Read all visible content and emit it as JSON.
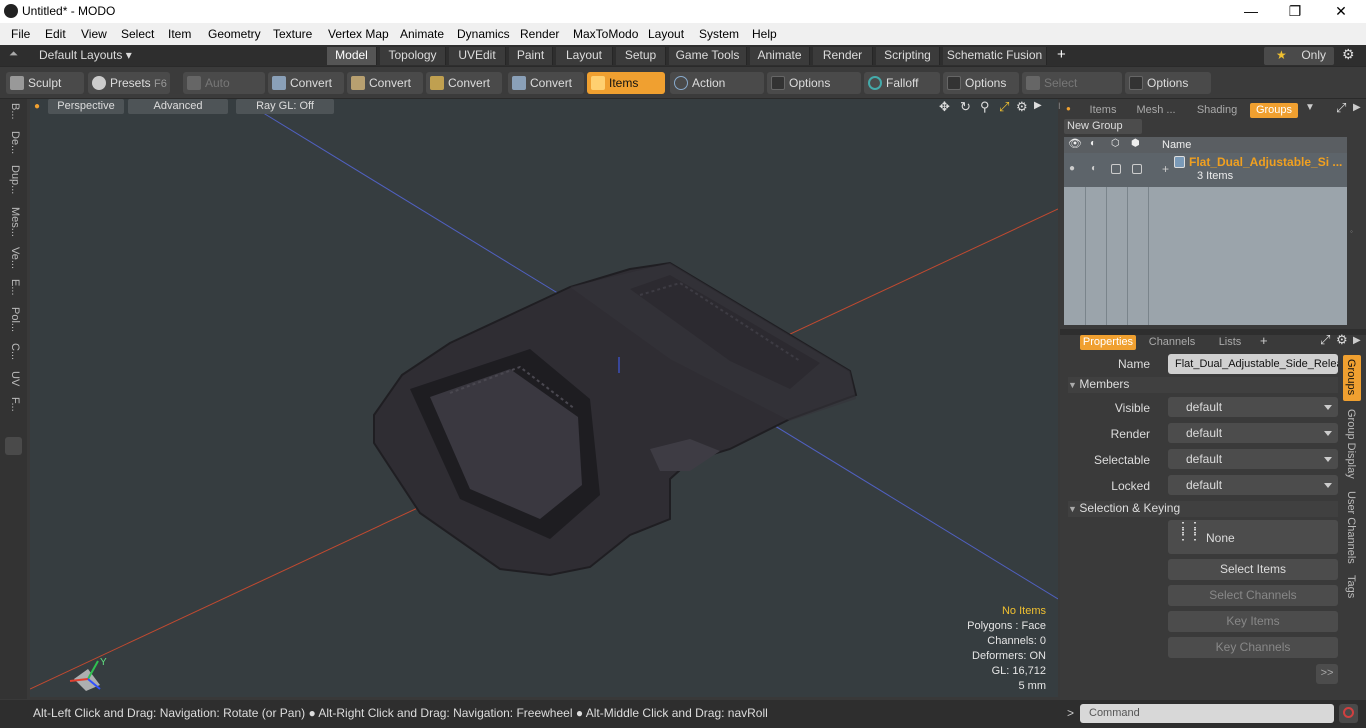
{
  "window": {
    "title": "Untitled* - MODO",
    "minimize": "—",
    "maximize": "❐",
    "close": "✕"
  },
  "menu": [
    "File",
    "Edit",
    "View",
    "Select",
    "Item",
    "Geometry",
    "Texture",
    "Vertex Map",
    "Animate",
    "Dynamics",
    "Render",
    "MaxToModo",
    "Layout",
    "System",
    "Help"
  ],
  "layouts": {
    "label": "Default Layouts ▾"
  },
  "tabs": [
    "Model",
    "Topology",
    "UVEdit",
    "Paint",
    "Layout",
    "Setup",
    "Game Tools",
    "Animate",
    "Render",
    "Scripting",
    "Schematic Fusion"
  ],
  "only": "Only",
  "toolbar": {
    "sculpt": "Sculpt",
    "presets": "Presets",
    "presets_key": "F6",
    "auto_select": "Auto Select",
    "convert": "Convert",
    "items": "Items",
    "action_center": "Action Center",
    "options": "Options",
    "falloff": "Falloff",
    "select_through": "Select Through"
  },
  "left_tabs": [
    "B...",
    "De...",
    "Dup...",
    "Mes...",
    "Ve...",
    "E...",
    "Pol...",
    "C...",
    "UV",
    "F..."
  ],
  "viewport": {
    "perspective": "Perspective",
    "advanced": "Advanced",
    "raygl": "Ray GL: Off"
  },
  "hud": {
    "selection": "No Items",
    "polygons": "Polygons : Face",
    "channels": "Channels: 0",
    "deformers": "Deformers: ON",
    "gl": "GL: 16,712",
    "unit": "5 mm"
  },
  "status": "Alt-Left Click and Drag: Navigation: Rotate (or Pan) ● Alt-Right Click and Drag: Navigation: Freewheel ● Alt-Middle Click and Drag: navRoll",
  "right_tabs": [
    "Items",
    "Mesh ...",
    "Shading",
    "Groups"
  ],
  "new_group": "New Group",
  "group_header": "Name",
  "group": {
    "name": "Flat_Dual_Adjustable_Si ...",
    "count": "3 Items"
  },
  "prop_tabs": [
    "Properties",
    "Channels",
    "Lists"
  ],
  "props": {
    "name_label": "Name",
    "name_value": "Flat_Dual_Adjustable_Side_Relea",
    "members": "Members",
    "visible": "Visible",
    "render": "Render",
    "selectable": "Selectable",
    "locked": "Locked",
    "default": "default",
    "sel_keying": "Selection & Keying",
    "none": "None",
    "select_items": "Select Items",
    "select_channels": "Select Channels",
    "key_items": "Key Items",
    "key_channels": "Key Channels",
    "more": ">>"
  },
  "side_vtabs": [
    "Groups",
    "Group Display",
    "User Channels",
    "Tags"
  ],
  "command": "Command"
}
